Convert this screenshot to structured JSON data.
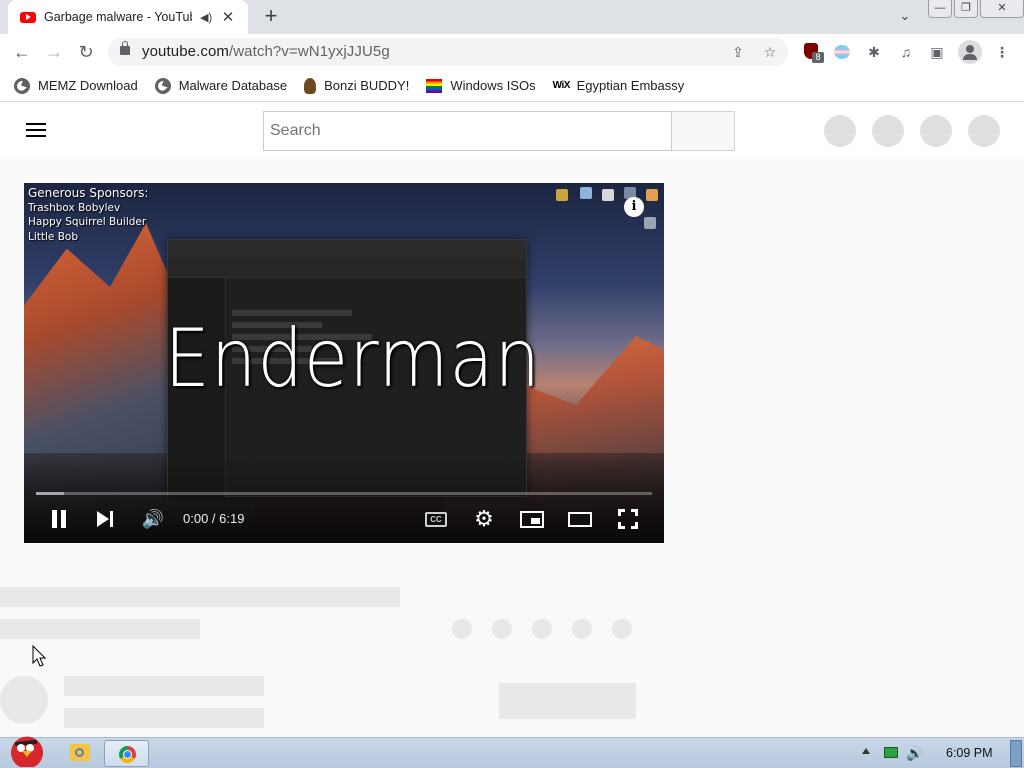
{
  "browser": {
    "tab": {
      "title": "Garbage malware - YouTube",
      "audio_icon": "speaker-icon",
      "close_glyph": "✕"
    },
    "new_tab_glyph": "+",
    "tab_search_glyph": "⌄",
    "window_controls": {
      "minimize": "—",
      "restore": "❐",
      "close": "✕"
    },
    "nav": {
      "back": "←",
      "forward": "→",
      "reload": "↻"
    },
    "address": {
      "host": "youtube.com",
      "path": "/watch?v=wN1yxjJJU5g"
    },
    "omnibox_icons": {
      "share": "⇪",
      "bookmark": "☆"
    },
    "extensions": {
      "ublock_count": "8",
      "puzzle": "✱",
      "media": "♫",
      "side_panel": "▣",
      "menu": "⋮"
    },
    "bookmarks": [
      {
        "label": "MEMZ Download",
        "icon": "globe-icon"
      },
      {
        "label": "Malware Database",
        "icon": "globe-icon"
      },
      {
        "label": "Bonzi BUDDY!",
        "icon": "bonzi-icon"
      },
      {
        "label": "Windows ISOs",
        "icon": "rainbow-flag-icon"
      },
      {
        "label": "Egyptian Embassy",
        "icon": "wix-icon",
        "icon_text": "WiX"
      }
    ]
  },
  "youtube": {
    "search": {
      "placeholder": "Search"
    },
    "video": {
      "overlay_title": "Enderman",
      "sponsors_heading": "Generous Sponsors:",
      "sponsors": [
        "Trashbox Bobylev",
        "Happy Squirrel Builder",
        "Little Bob"
      ],
      "info_glyph": "i",
      "time": "0:00 / 6:19",
      "progress": 0.045,
      "cc_label": "CC",
      "settings_glyph": "⚙",
      "volume_glyph": "🔊"
    }
  },
  "taskbar": {
    "clock": "6:09 PM",
    "volume_glyph": "🔊"
  }
}
